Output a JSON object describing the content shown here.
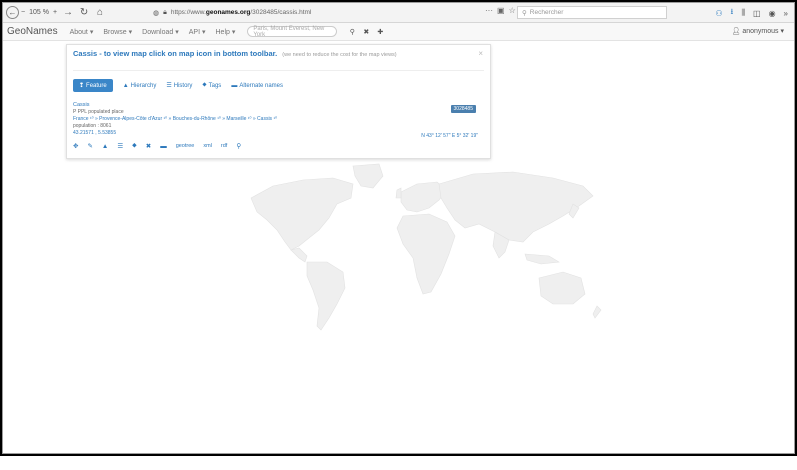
{
  "browser": {
    "zoom_minus": "−",
    "zoom_level": "105 %",
    "zoom_plus": "+",
    "url_prefix": "https://www.",
    "url_domain": "geonames.org",
    "url_path": "/3028485/cassis.html",
    "search_placeholder": "Rechercher",
    "more": "»",
    "page_actions": "···"
  },
  "site": {
    "brand": "GeoNames",
    "menu": [
      "About ▾",
      "Browse ▾",
      "Download ▾",
      "API ▾",
      "Help ▾"
    ],
    "search_placeholder": "Paris, Mount Everest, New York",
    "user": "anonymous ▾"
  },
  "panel": {
    "title": "Cassis - to view map click on map icon in bottom toolbar.",
    "hint": "(we need to reduce the cost for the map views)",
    "close": "×",
    "tabs": [
      {
        "icon": "❢",
        "label": "Feature"
      },
      {
        "icon": "▲",
        "label": "Hierarchy"
      },
      {
        "icon": "☰",
        "label": "History"
      },
      {
        "icon": "⬥",
        "label": "Tags"
      },
      {
        "icon": "▬",
        "label": "Alternate names"
      }
    ],
    "place_name": "Cassis",
    "feature_line": "P  PPL  populated place",
    "hierarchy_line": "France ¹⁰ » Provence-Alpes-Côte d'Azur ¹⁰ » Bouches-du-Rhône ¹⁰ » Marseille ¹⁰ » Cassis ¹⁰",
    "population": "population : 8061",
    "latlng": "43.21571 , 5.53855",
    "id_badge": "3028485",
    "dms": "N 43° 12' 57\"  E 5° 32' 19\"",
    "actions": [
      "✥",
      "✎",
      "▲",
      "☰",
      "⬥",
      "✖",
      "▬"
    ],
    "action_links": [
      "geotree",
      "xml",
      "rdf"
    ],
    "map_marker": "⚲"
  }
}
